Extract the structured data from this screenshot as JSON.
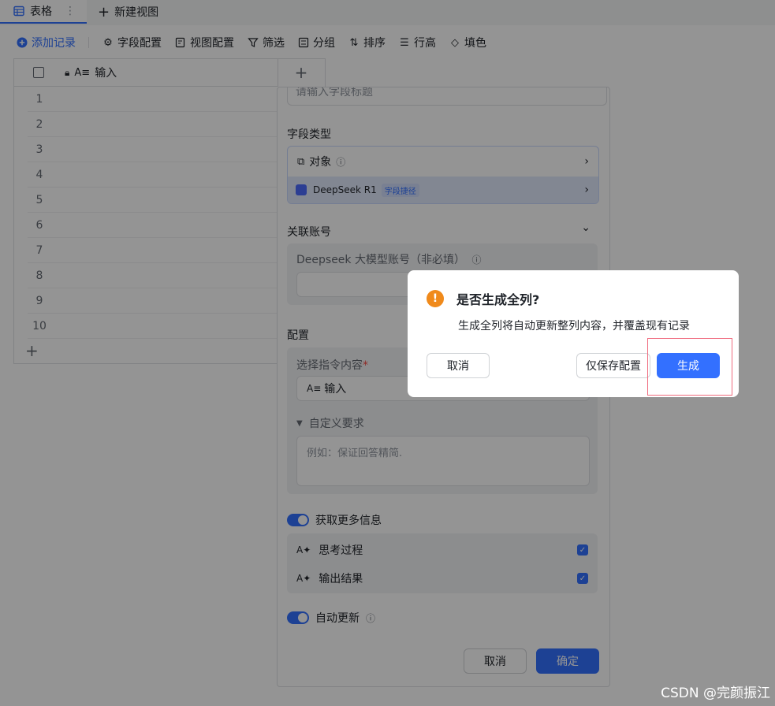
{
  "tabs": {
    "table_label": "表格",
    "new_view_label": "新建视图"
  },
  "toolbar": {
    "add_record": "添加记录",
    "field_config": "字段配置",
    "view_config": "视图配置",
    "filter": "筛选",
    "group": "分组",
    "sort": "排序",
    "row_height": "行高",
    "fill_color": "填色"
  },
  "grid": {
    "column_header": "输入",
    "rows": [
      "1",
      "2",
      "3",
      "4",
      "5",
      "6",
      "7",
      "8",
      "9",
      "10"
    ]
  },
  "panel": {
    "title_placeholder": "请输入字段标题",
    "field_type_label": "字段类型",
    "field_type_value": "对象",
    "shortcut_name": "DeepSeek R1",
    "shortcut_tag": "字段捷径",
    "account_label": "关联账号",
    "account_field_label": "Deepseek 大模型账号（非必填）",
    "config_label": "配置",
    "instruction_label": "选择指令内容",
    "instruction_required": "*",
    "instruction_value": "输入",
    "custom_label": "自定义要求",
    "custom_placeholder": "例如：保证回答精简.",
    "more_info_label": "获取更多信息",
    "outputs": [
      {
        "label": "思考过程"
      },
      {
        "label": "输出结果"
      }
    ],
    "auto_update_label": "自动更新",
    "cancel": "取消",
    "confirm": "确定"
  },
  "dialog": {
    "title": "是否生成全列?",
    "body": "生成全列将自动更新整列内容，并覆盖现有记录",
    "cancel": "取消",
    "save_only": "仅保存配置",
    "generate": "生成"
  },
  "watermark": "CSDN @完颜振江",
  "colors": {
    "accent": "#3370ff",
    "warning": "#f08a1b",
    "highlight": "#ef6b7e"
  }
}
